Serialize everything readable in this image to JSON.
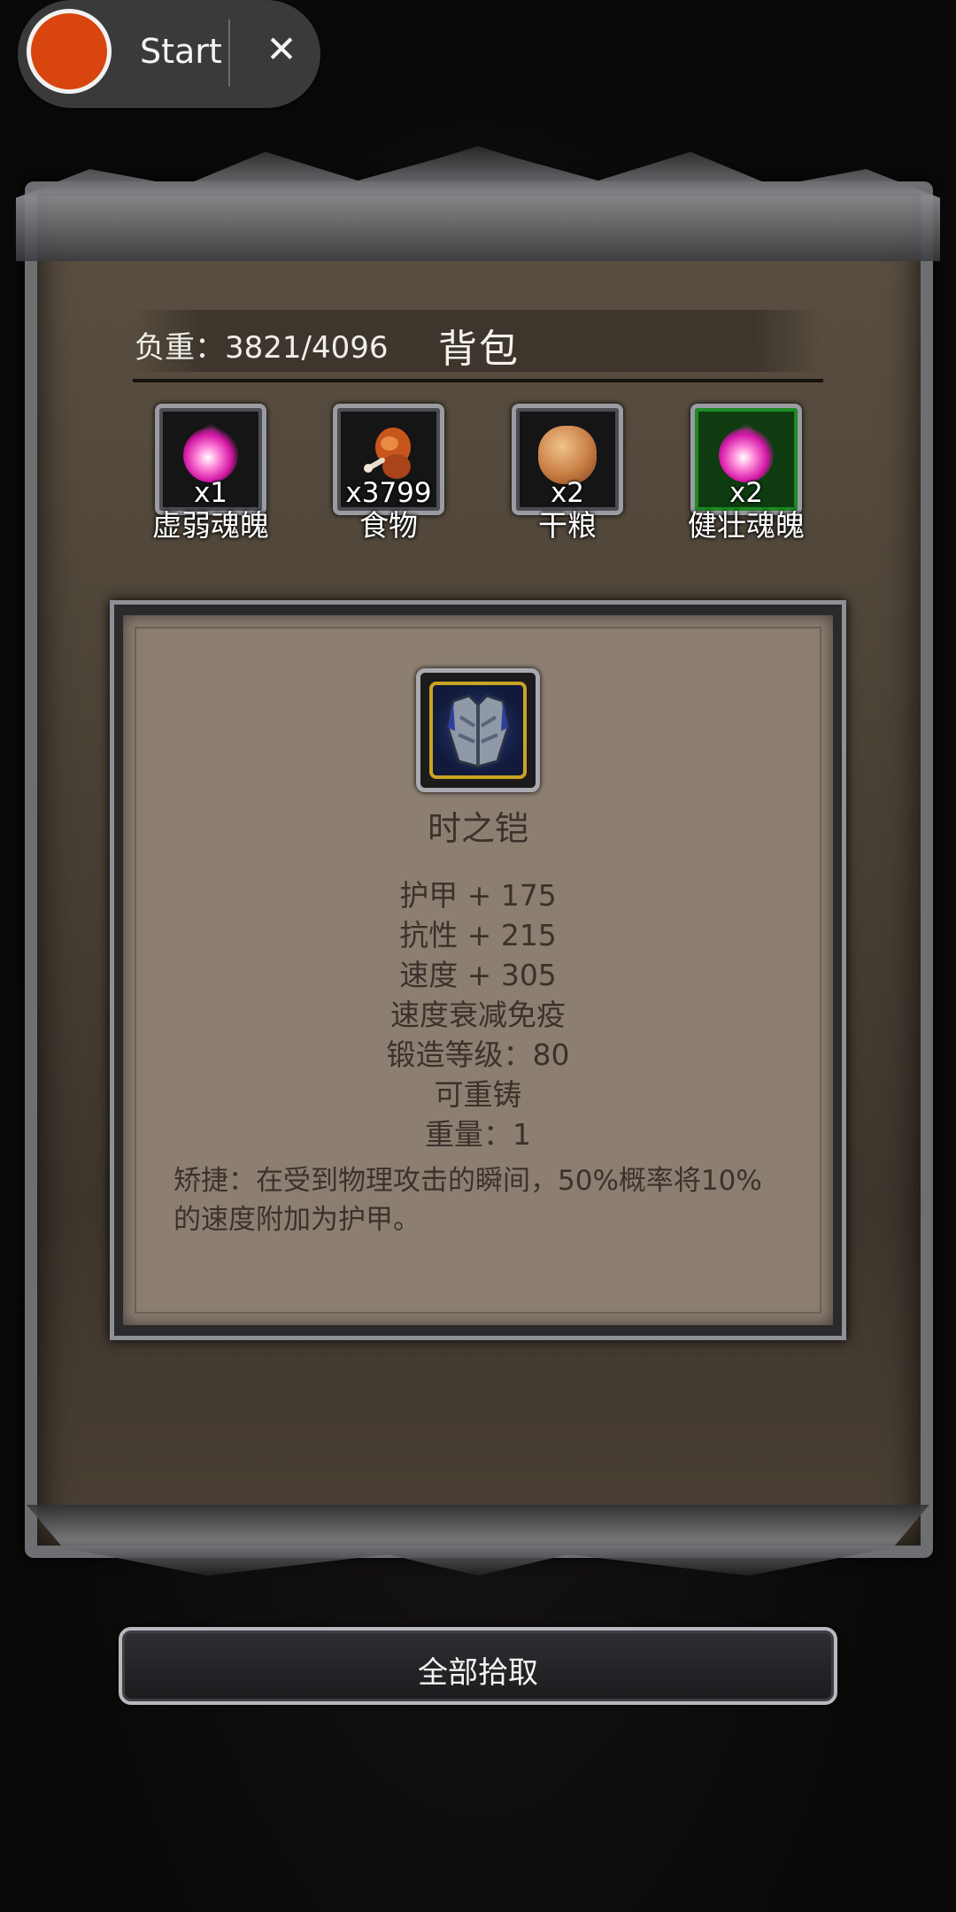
{
  "recorder": {
    "label": "Start",
    "close": "✕"
  },
  "header": {
    "weight": "负重：3821/4096",
    "title": "背包"
  },
  "slots": [
    {
      "qty": "x1",
      "name": "虚弱魂魄",
      "icon": "weak-soul-icon"
    },
    {
      "qty": "x3799",
      "name": "食物",
      "icon": "meat-icon"
    },
    {
      "qty": "x2",
      "name": "干粮",
      "icon": "bread-icon"
    },
    {
      "qty": "x2",
      "name": "健壮魂魄",
      "icon": "strong-soul-icon"
    }
  ],
  "detail": {
    "icon": "armor-icon",
    "name": "时之铠",
    "stats": [
      "护甲 + 175",
      "抗性 + 215",
      "速度 + 305",
      "速度衰减免疫",
      "锻造等级：80",
      "可重铸",
      "重量：1"
    ],
    "description": "矫捷：在受到物理攻击的瞬间，50%概率将10%的速度附加为护甲。"
  },
  "actions": {
    "pick_all": "全部拾取"
  },
  "colors": {
    "rarity_green": "#1f8a24",
    "rarity_gold": "#c9a524",
    "record_red": "#d9450f"
  }
}
